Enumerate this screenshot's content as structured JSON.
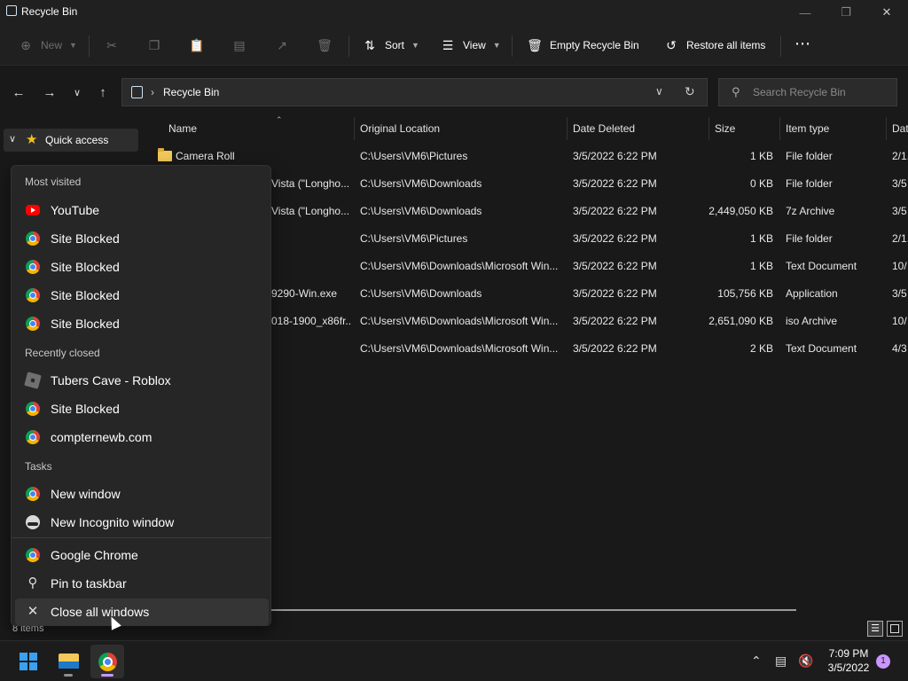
{
  "window": {
    "title": "Recycle Bin"
  },
  "commands": {
    "new": "New",
    "sort": "Sort",
    "view": "View",
    "empty_bin": "Empty Recycle Bin",
    "restore_all": "Restore all items"
  },
  "address": {
    "path": "Recycle Bin"
  },
  "search": {
    "placeholder": "Search Recycle Bin"
  },
  "sidebar": {
    "quick_access": "Quick access"
  },
  "columns": {
    "name": "Name",
    "original_location": "Original Location",
    "date_deleted": "Date Deleted",
    "size": "Size",
    "item_type": "Item type",
    "date_modified": "Dat"
  },
  "files": [
    {
      "name": "Camera Roll",
      "location": "C:\\Users\\VM6\\Pictures",
      "deleted": "3/5/2022 6:22 PM",
      "size": "1 KB",
      "type": "File folder",
      "modified": "2/1."
    },
    {
      "name": "Vista (\"Longho...",
      "location": "C:\\Users\\VM6\\Downloads",
      "deleted": "3/5/2022 6:22 PM",
      "size": "0 KB",
      "type": "File folder",
      "modified": "3/5"
    },
    {
      "name": "Vista (\"Longho...",
      "location": "C:\\Users\\VM6\\Downloads",
      "deleted": "3/5/2022 6:22 PM",
      "size": "2,449,050 KB",
      "type": "7z Archive",
      "modified": "3/5"
    },
    {
      "name": "",
      "location": "C:\\Users\\VM6\\Pictures",
      "deleted": "3/5/2022 6:22 PM",
      "size": "1 KB",
      "type": "File folder",
      "modified": "2/1."
    },
    {
      "name": "",
      "location": "C:\\Users\\VM6\\Downloads\\Microsoft Win...",
      "deleted": "3/5/2022 6:22 PM",
      "size": "1 KB",
      "type": "Text Document",
      "modified": "10/"
    },
    {
      "name": "9290-Win.exe",
      "location": "C:\\Users\\VM6\\Downloads",
      "deleted": "3/5/2022 6:22 PM",
      "size": "105,756 KB",
      "type": "Application",
      "modified": "3/5"
    },
    {
      "name": "018-1900_x86fr...",
      "location": "C:\\Users\\VM6\\Downloads\\Microsoft Win...",
      "deleted": "3/5/2022 6:22 PM",
      "size": "2,651,090 KB",
      "type": "iso Archive",
      "modified": "10/"
    },
    {
      "name": "",
      "location": "C:\\Users\\VM6\\Downloads\\Microsoft Win...",
      "deleted": "3/5/2022 6:22 PM",
      "size": "2 KB",
      "type": "Text Document",
      "modified": "4/3"
    }
  ],
  "status": {
    "count": "8 items"
  },
  "jumplist": {
    "most_visited_header": "Most visited",
    "most_visited": [
      "YouTube",
      "Site Blocked",
      "Site Blocked",
      "Site Blocked",
      "Site Blocked"
    ],
    "recently_closed_header": "Recently closed",
    "recently_closed": [
      "Tubers Cave - Roblox",
      "Site Blocked",
      "compternewb.com"
    ],
    "tasks_header": "Tasks",
    "tasks": [
      "New window",
      "New Incognito window"
    ],
    "app": "Google Chrome",
    "pin": "Pin to taskbar",
    "close_all": "Close all windows"
  },
  "taskbar": {
    "time": "7:09 PM",
    "date": "3/5/2022",
    "notifications": "1"
  }
}
